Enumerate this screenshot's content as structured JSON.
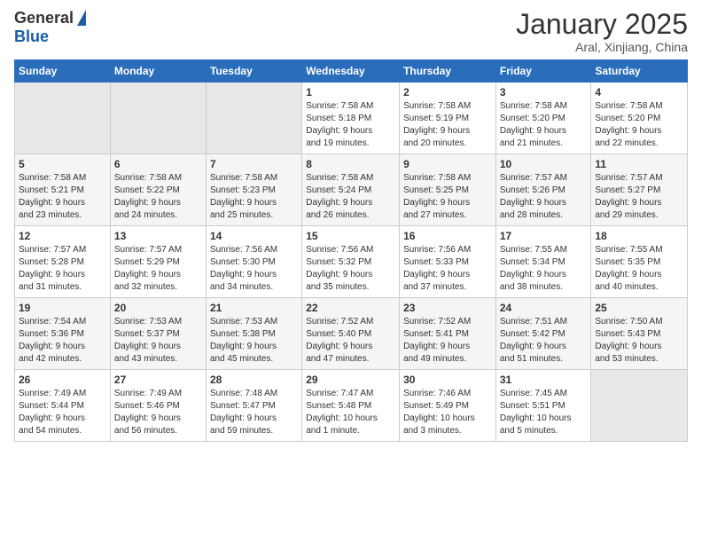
{
  "header": {
    "logo_general": "General",
    "logo_blue": "Blue",
    "month": "January 2025",
    "location": "Aral, Xinjiang, China"
  },
  "weekdays": [
    "Sunday",
    "Monday",
    "Tuesday",
    "Wednesday",
    "Thursday",
    "Friday",
    "Saturday"
  ],
  "weeks": [
    [
      {
        "day": "",
        "info": ""
      },
      {
        "day": "",
        "info": ""
      },
      {
        "day": "",
        "info": ""
      },
      {
        "day": "1",
        "info": "Sunrise: 7:58 AM\nSunset: 5:18 PM\nDaylight: 9 hours\nand 19 minutes."
      },
      {
        "day": "2",
        "info": "Sunrise: 7:58 AM\nSunset: 5:19 PM\nDaylight: 9 hours\nand 20 minutes."
      },
      {
        "day": "3",
        "info": "Sunrise: 7:58 AM\nSunset: 5:20 PM\nDaylight: 9 hours\nand 21 minutes."
      },
      {
        "day": "4",
        "info": "Sunrise: 7:58 AM\nSunset: 5:20 PM\nDaylight: 9 hours\nand 22 minutes."
      }
    ],
    [
      {
        "day": "5",
        "info": "Sunrise: 7:58 AM\nSunset: 5:21 PM\nDaylight: 9 hours\nand 23 minutes."
      },
      {
        "day": "6",
        "info": "Sunrise: 7:58 AM\nSunset: 5:22 PM\nDaylight: 9 hours\nand 24 minutes."
      },
      {
        "day": "7",
        "info": "Sunrise: 7:58 AM\nSunset: 5:23 PM\nDaylight: 9 hours\nand 25 minutes."
      },
      {
        "day": "8",
        "info": "Sunrise: 7:58 AM\nSunset: 5:24 PM\nDaylight: 9 hours\nand 26 minutes."
      },
      {
        "day": "9",
        "info": "Sunrise: 7:58 AM\nSunset: 5:25 PM\nDaylight: 9 hours\nand 27 minutes."
      },
      {
        "day": "10",
        "info": "Sunrise: 7:57 AM\nSunset: 5:26 PM\nDaylight: 9 hours\nand 28 minutes."
      },
      {
        "day": "11",
        "info": "Sunrise: 7:57 AM\nSunset: 5:27 PM\nDaylight: 9 hours\nand 29 minutes."
      }
    ],
    [
      {
        "day": "12",
        "info": "Sunrise: 7:57 AM\nSunset: 5:28 PM\nDaylight: 9 hours\nand 31 minutes."
      },
      {
        "day": "13",
        "info": "Sunrise: 7:57 AM\nSunset: 5:29 PM\nDaylight: 9 hours\nand 32 minutes."
      },
      {
        "day": "14",
        "info": "Sunrise: 7:56 AM\nSunset: 5:30 PM\nDaylight: 9 hours\nand 34 minutes."
      },
      {
        "day": "15",
        "info": "Sunrise: 7:56 AM\nSunset: 5:32 PM\nDaylight: 9 hours\nand 35 minutes."
      },
      {
        "day": "16",
        "info": "Sunrise: 7:56 AM\nSunset: 5:33 PM\nDaylight: 9 hours\nand 37 minutes."
      },
      {
        "day": "17",
        "info": "Sunrise: 7:55 AM\nSunset: 5:34 PM\nDaylight: 9 hours\nand 38 minutes."
      },
      {
        "day": "18",
        "info": "Sunrise: 7:55 AM\nSunset: 5:35 PM\nDaylight: 9 hours\nand 40 minutes."
      }
    ],
    [
      {
        "day": "19",
        "info": "Sunrise: 7:54 AM\nSunset: 5:36 PM\nDaylight: 9 hours\nand 42 minutes."
      },
      {
        "day": "20",
        "info": "Sunrise: 7:53 AM\nSunset: 5:37 PM\nDaylight: 9 hours\nand 43 minutes."
      },
      {
        "day": "21",
        "info": "Sunrise: 7:53 AM\nSunset: 5:38 PM\nDaylight: 9 hours\nand 45 minutes."
      },
      {
        "day": "22",
        "info": "Sunrise: 7:52 AM\nSunset: 5:40 PM\nDaylight: 9 hours\nand 47 minutes."
      },
      {
        "day": "23",
        "info": "Sunrise: 7:52 AM\nSunset: 5:41 PM\nDaylight: 9 hours\nand 49 minutes."
      },
      {
        "day": "24",
        "info": "Sunrise: 7:51 AM\nSunset: 5:42 PM\nDaylight: 9 hours\nand 51 minutes."
      },
      {
        "day": "25",
        "info": "Sunrise: 7:50 AM\nSunset: 5:43 PM\nDaylight: 9 hours\nand 53 minutes."
      }
    ],
    [
      {
        "day": "26",
        "info": "Sunrise: 7:49 AM\nSunset: 5:44 PM\nDaylight: 9 hours\nand 54 minutes."
      },
      {
        "day": "27",
        "info": "Sunrise: 7:49 AM\nSunset: 5:46 PM\nDaylight: 9 hours\nand 56 minutes."
      },
      {
        "day": "28",
        "info": "Sunrise: 7:48 AM\nSunset: 5:47 PM\nDaylight: 9 hours\nand 59 minutes."
      },
      {
        "day": "29",
        "info": "Sunrise: 7:47 AM\nSunset: 5:48 PM\nDaylight: 10 hours\nand 1 minute."
      },
      {
        "day": "30",
        "info": "Sunrise: 7:46 AM\nSunset: 5:49 PM\nDaylight: 10 hours\nand 3 minutes."
      },
      {
        "day": "31",
        "info": "Sunrise: 7:45 AM\nSunset: 5:51 PM\nDaylight: 10 hours\nand 5 minutes."
      },
      {
        "day": "",
        "info": ""
      }
    ]
  ]
}
